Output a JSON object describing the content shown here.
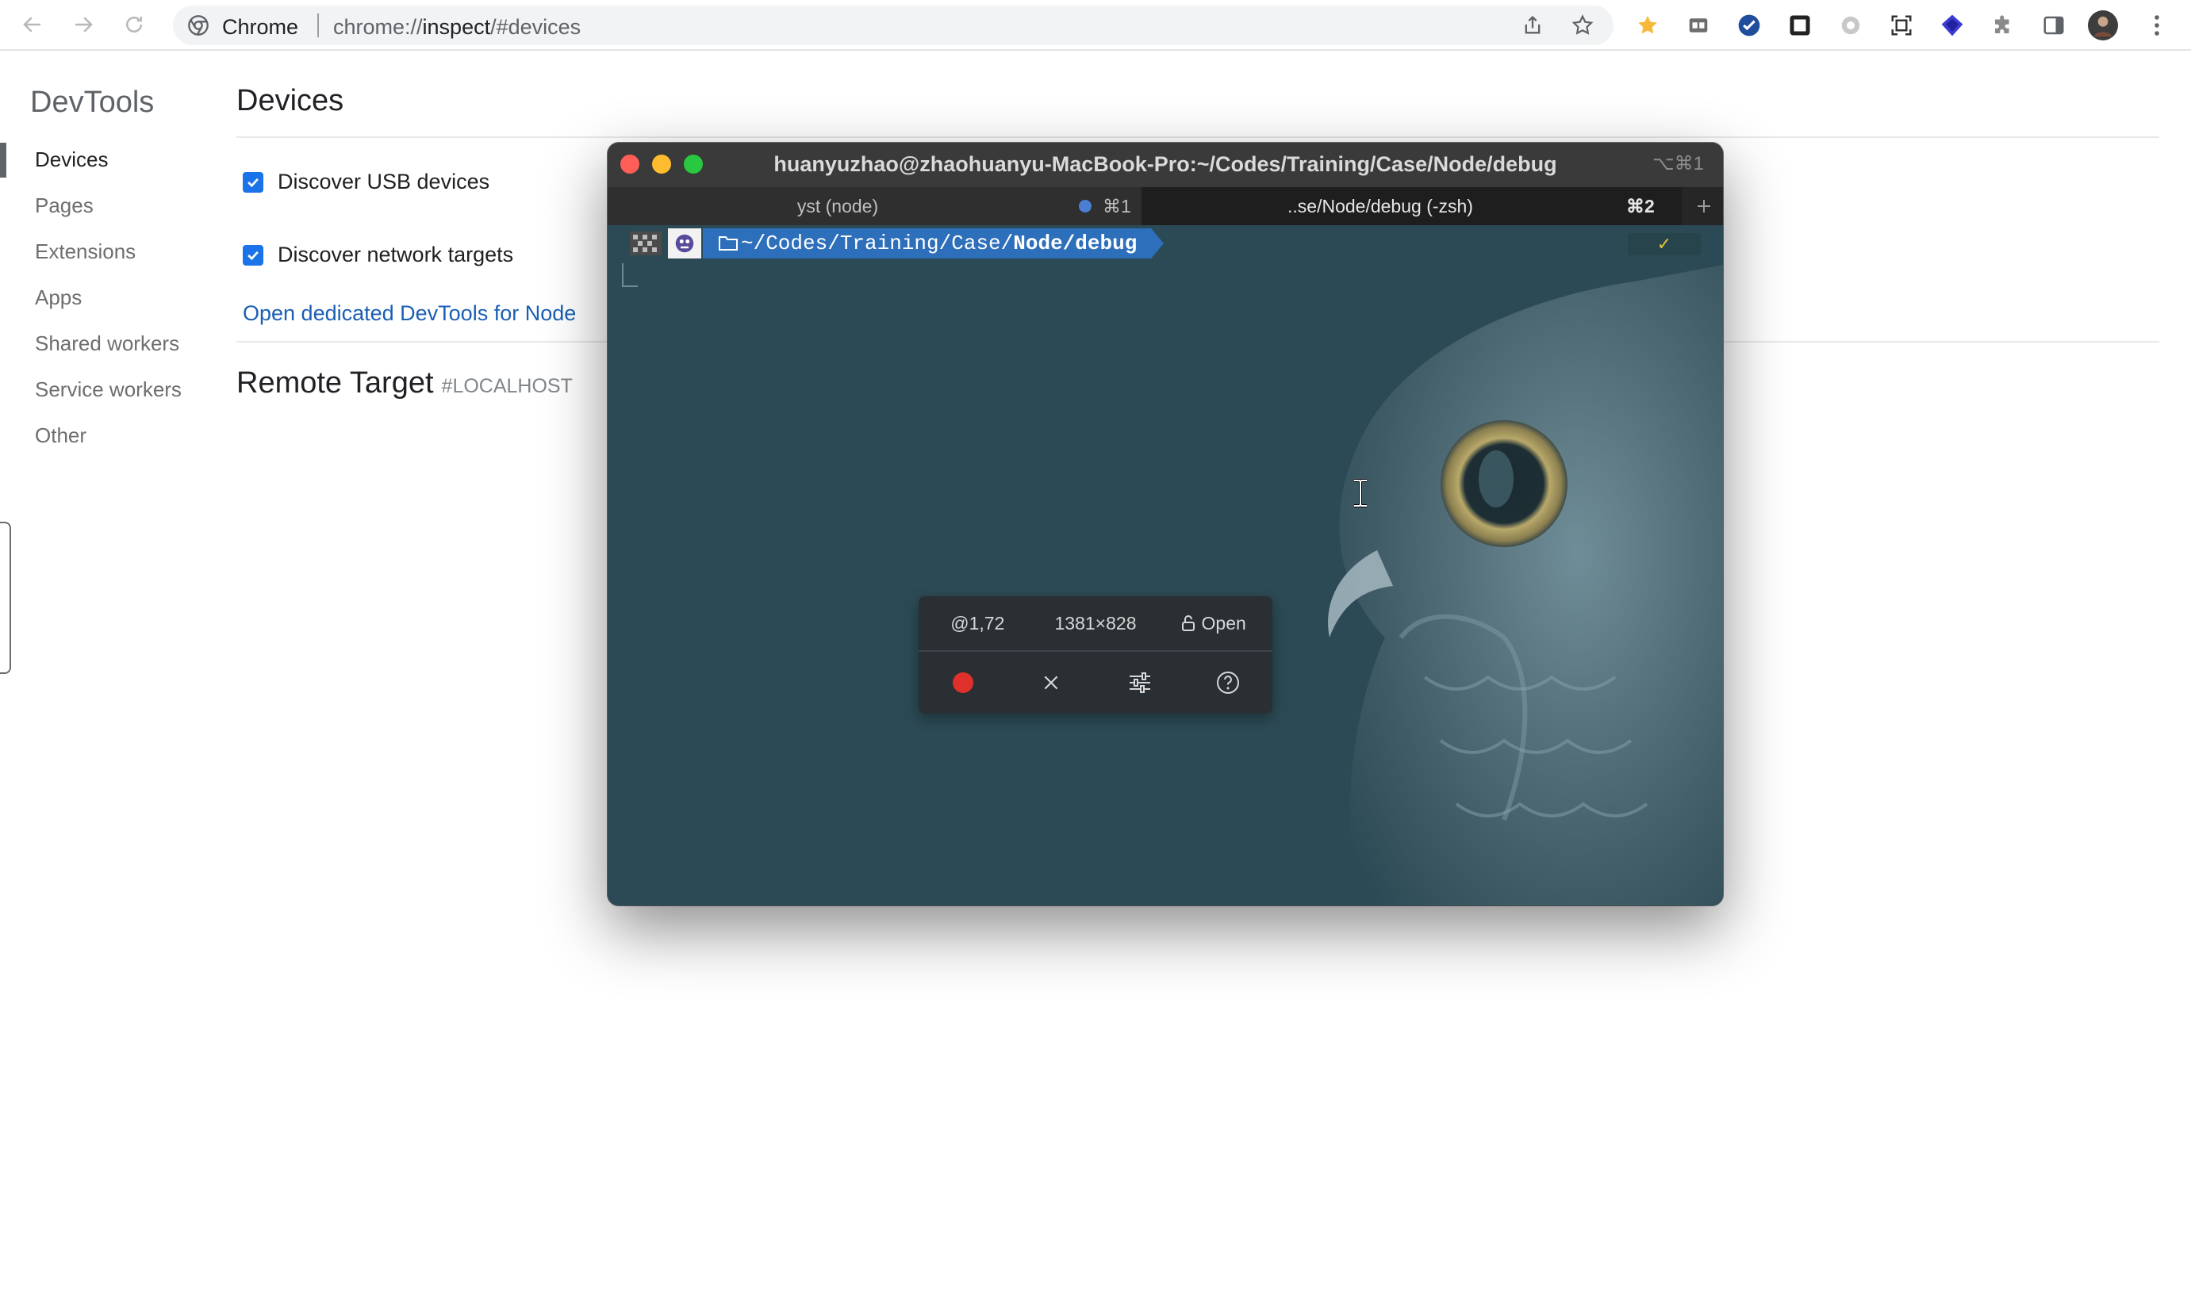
{
  "browser": {
    "site_label": "Chrome",
    "url_prefix": "chrome://",
    "url_host": "inspect",
    "url_suffix": "/#devices"
  },
  "devtools": {
    "brand": "DevTools",
    "heading": "Devices",
    "sidebar": [
      "Devices",
      "Pages",
      "Extensions",
      "Apps",
      "Shared workers",
      "Service workers",
      "Other"
    ],
    "active_item": "Devices",
    "discover_usb_label": "Discover USB devices",
    "discover_usb_checked": true,
    "discover_network_label": "Discover network targets",
    "discover_network_checked": true,
    "open_node_link": "Open dedicated DevTools for Node",
    "remote_target_title": "Remote Target",
    "remote_target_tag": "#LOCALHOST"
  },
  "terminal": {
    "title": "huanyuzhao@zhaohuanyu-MacBook-Pro:~/Codes/Training/Case/Node/debug",
    "title_shortcut": "⌥⌘1",
    "tabs": [
      {
        "label": "yst (node)",
        "shortcut": "⌘1",
        "indicator_color": "#4a7fd4"
      },
      {
        "label": "..se/Node/debug (-zsh)",
        "shortcut": "⌘2",
        "active": true
      }
    ],
    "prompt_path_prefix": "~/Codes/Training/Case/",
    "prompt_path_bold": "Node/debug",
    "prompt_status": "✓",
    "prompt_color": "#2d6fba"
  },
  "capture_toolbar": {
    "position": "@1,72",
    "size": "1381×828",
    "lock_label": "Open",
    "record_color": "#e0302b"
  }
}
